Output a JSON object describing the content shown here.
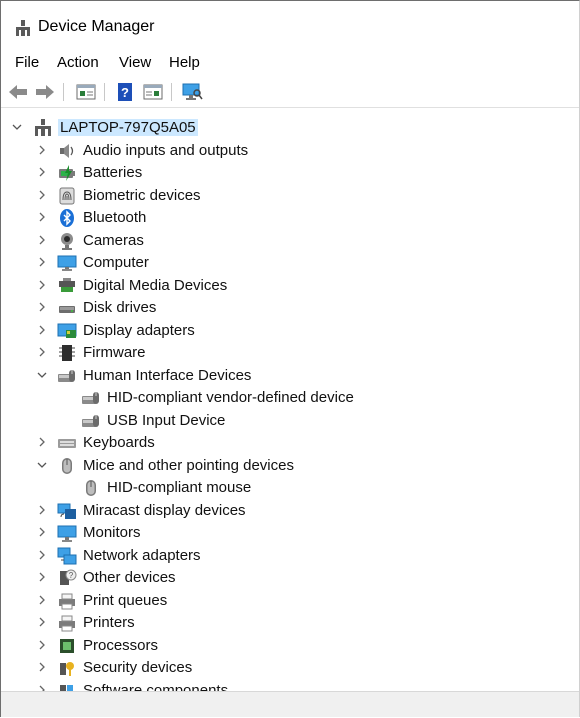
{
  "window": {
    "title": "Device Manager"
  },
  "menu": [
    "File",
    "Action",
    "View",
    "Help"
  ],
  "toolbar": [
    "back-icon",
    "forward-icon",
    "properties-icon",
    "help-icon",
    "update-driver-icon",
    "scan-hardware-icon"
  ],
  "tree": {
    "root": "LAPTOP-797Q5A05",
    "nodes": [
      {
        "label": "Audio inputs and outputs",
        "icon": "audio-icon",
        "expanded": false
      },
      {
        "label": "Batteries",
        "icon": "battery-icon",
        "expanded": false
      },
      {
        "label": "Biometric devices",
        "icon": "fingerprint-icon",
        "expanded": false
      },
      {
        "label": "Bluetooth",
        "icon": "bluetooth-icon",
        "expanded": false
      },
      {
        "label": "Cameras",
        "icon": "camera-icon",
        "expanded": false
      },
      {
        "label": "Computer",
        "icon": "computer-icon",
        "expanded": false
      },
      {
        "label": "Digital Media Devices",
        "icon": "media-device-icon",
        "expanded": false
      },
      {
        "label": "Disk drives",
        "icon": "disk-icon",
        "expanded": false
      },
      {
        "label": "Display adapters",
        "icon": "display-adapter-icon",
        "expanded": false
      },
      {
        "label": "Firmware",
        "icon": "firmware-icon",
        "expanded": false
      },
      {
        "label": "Human Interface Devices",
        "icon": "hid-icon",
        "expanded": true,
        "children": [
          {
            "label": "HID-compliant vendor-defined device",
            "icon": "hid-icon"
          },
          {
            "label": "USB Input Device",
            "icon": "hid-icon"
          }
        ]
      },
      {
        "label": "Keyboards",
        "icon": "keyboard-icon",
        "expanded": false
      },
      {
        "label": "Mice and other pointing devices",
        "icon": "mouse-icon",
        "expanded": true,
        "children": [
          {
            "label": "HID-compliant mouse",
            "icon": "mouse-icon"
          }
        ]
      },
      {
        "label": "Miracast display devices",
        "icon": "miracast-icon",
        "expanded": false
      },
      {
        "label": "Monitors",
        "icon": "monitor-icon",
        "expanded": false
      },
      {
        "label": "Network adapters",
        "icon": "network-icon",
        "expanded": false
      },
      {
        "label": "Other devices",
        "icon": "other-devices-icon",
        "expanded": false
      },
      {
        "label": "Print queues",
        "icon": "print-queue-icon",
        "expanded": false
      },
      {
        "label": "Printers",
        "icon": "printer-icon",
        "expanded": false
      },
      {
        "label": "Processors",
        "icon": "processor-icon",
        "expanded": false
      },
      {
        "label": "Security devices",
        "icon": "security-icon",
        "expanded": false
      },
      {
        "label": "Software components",
        "icon": "software-component-icon",
        "expanded": false
      }
    ]
  },
  "colors": {
    "selection": "#cce8ff",
    "accent": "#0a64d6"
  }
}
